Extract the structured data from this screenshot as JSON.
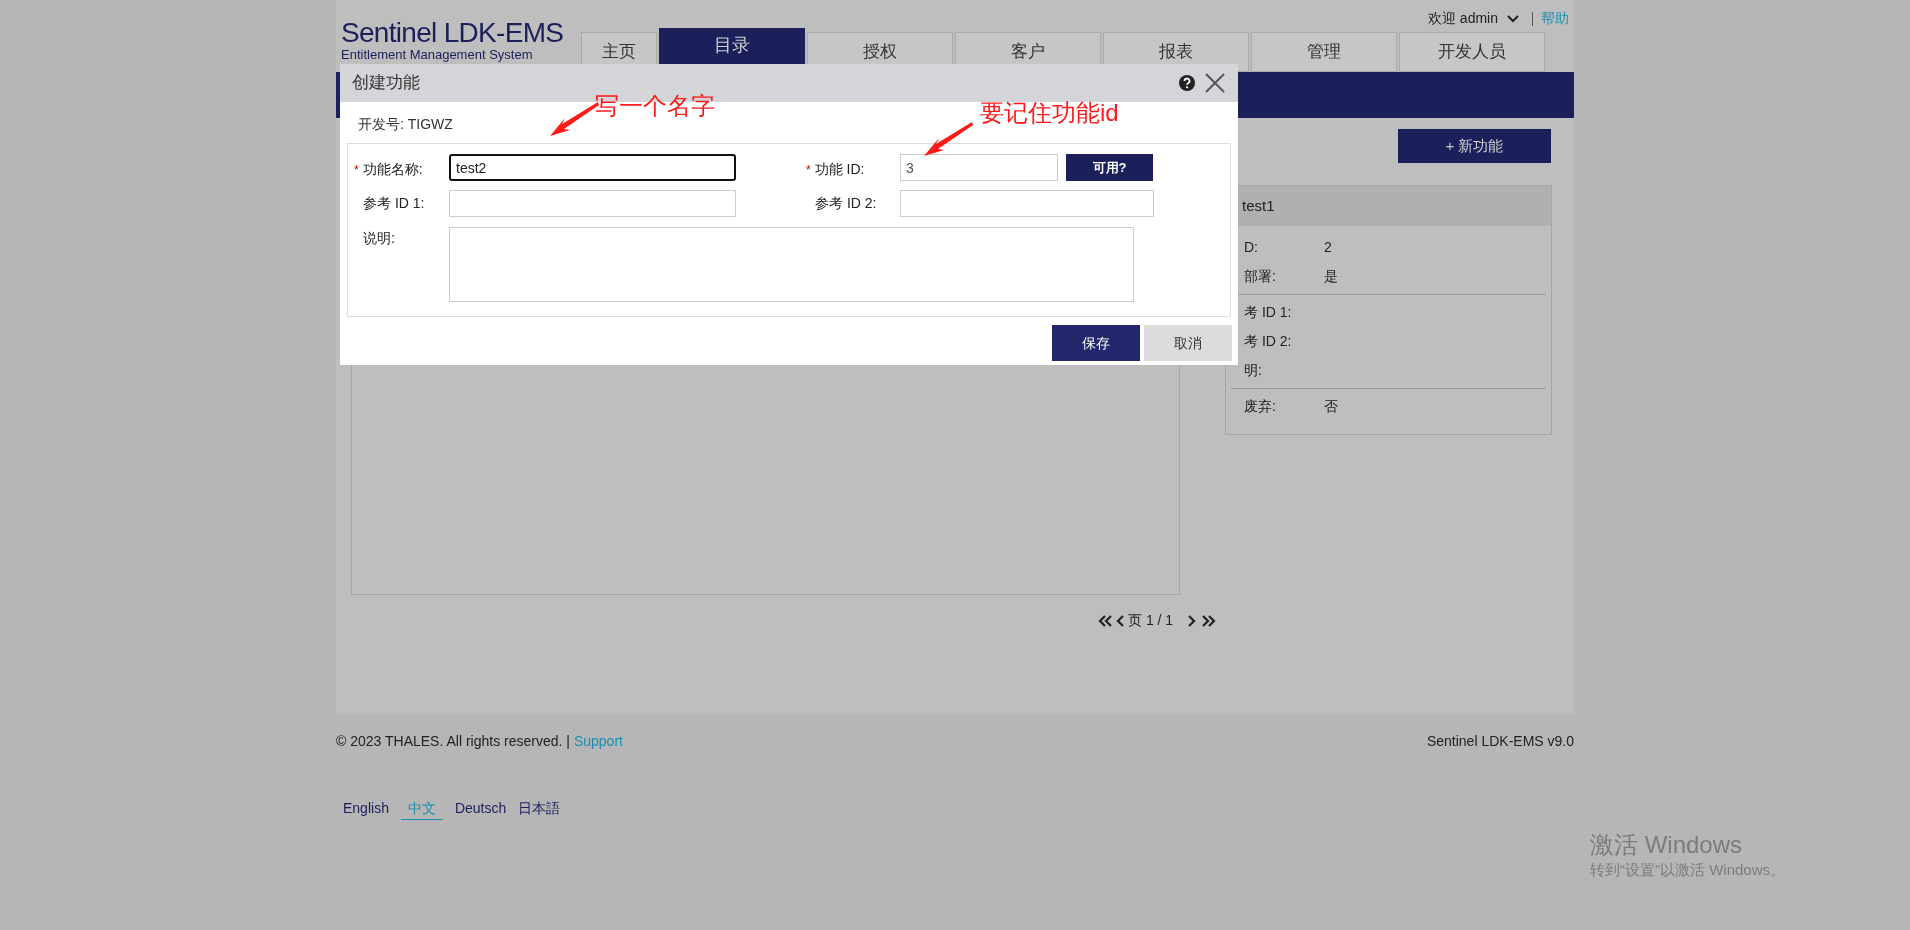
{
  "header": {
    "logo_title": "Sentinel LDK-EMS",
    "logo_subtitle": "Entitlement Management System",
    "welcome": "欢迎 admin",
    "help": "帮助"
  },
  "tabs": [
    {
      "label": "主页",
      "selected": false
    },
    {
      "label": "目录",
      "selected": true
    },
    {
      "label": "授权",
      "selected": false
    },
    {
      "label": "客户",
      "selected": false
    },
    {
      "label": "报表",
      "selected": false
    },
    {
      "label": "管理",
      "selected": false
    },
    {
      "label": "开发人员",
      "selected": false
    }
  ],
  "new_feature_button": "+ 新功能",
  "detail_card": {
    "title": "test1",
    "groups": [
      [
        {
          "label": "D:",
          "value": "2"
        },
        {
          "label": "部署:",
          "value": "是"
        }
      ],
      [
        {
          "label": "考 ID 1:"
        },
        {
          "label": "考 ID 2:"
        },
        {
          "label": "明:"
        }
      ],
      [
        {
          "label": "废弃:",
          "value": "否"
        }
      ]
    ]
  },
  "pagination": {
    "text": "页 1 / 1"
  },
  "footer": {
    "copyright": "© 2023 THALES. All rights reserved. |",
    "support": "Support",
    "version": "Sentinel LDK-EMS v9.0"
  },
  "languages": [
    {
      "label": "English",
      "selected": false
    },
    {
      "label": "中文",
      "selected": true
    },
    {
      "label": "Deutsch",
      "selected": false
    },
    {
      "label": "日本語",
      "selected": false
    }
  ],
  "dialog": {
    "title": "创建功能",
    "vendor": "开发号: TIGWZ",
    "name_label": "功能名称:",
    "name_value": "test2",
    "name_focused": true,
    "id_label": "功能 ID:",
    "id_value": "3",
    "check_button": "可用?",
    "ref1_label": "参考 ID 1:",
    "ref2_label": "参考 ID 2:",
    "desc_label": "说明:",
    "save": "保存",
    "cancel": "取消",
    "required_mark": "*"
  },
  "annotations": [
    {
      "text": "写一个名字"
    },
    {
      "text": "要记住功能id"
    }
  ],
  "os_notice": {
    "title": "激活 Windows",
    "subtitle": "转到“设置”以激活 Windows。"
  }
}
